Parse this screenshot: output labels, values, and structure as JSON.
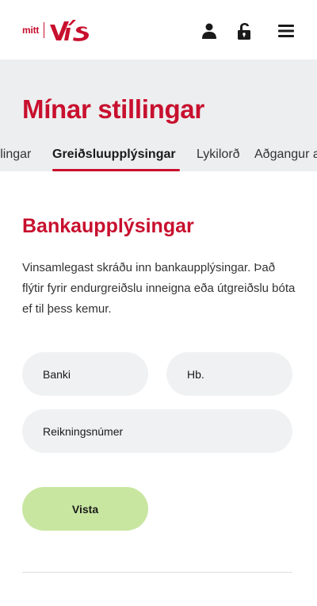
{
  "header": {
    "logo_prefix": "mitt",
    "logo_name": "VÍS",
    "icons": [
      "user-icon",
      "lock-open-icon",
      "hamburger-menu-icon"
    ],
    "brand_color": "#c8102e"
  },
  "page": {
    "title": "Mínar stillingar"
  },
  "tabs": [
    {
      "label": "Stillingar",
      "active": false
    },
    {
      "label": "Greiðsluupplýsingar",
      "active": true
    },
    {
      "label": "Lykilorð",
      "active": false
    },
    {
      "label": "Aðgangur að gögnum",
      "active": false
    }
  ],
  "section": {
    "title": "Bankaupplýsingar",
    "description": "Vinsamlegast skráðu inn bankaupplýsingar. Það flýtir fyrir endurgreiðslu inneigna eða útgreiðslu bóta ef til þess kemur."
  },
  "form": {
    "bank_placeholder": "Banki",
    "hb_placeholder": "Hb.",
    "account_placeholder": "Reikningsnúmer",
    "save_label": "Vista"
  },
  "colors": {
    "accent": "#c8102e",
    "save_button": "#c8e6a0",
    "title_band": "#edeeef",
    "field_bg": "#f0f1f2"
  }
}
